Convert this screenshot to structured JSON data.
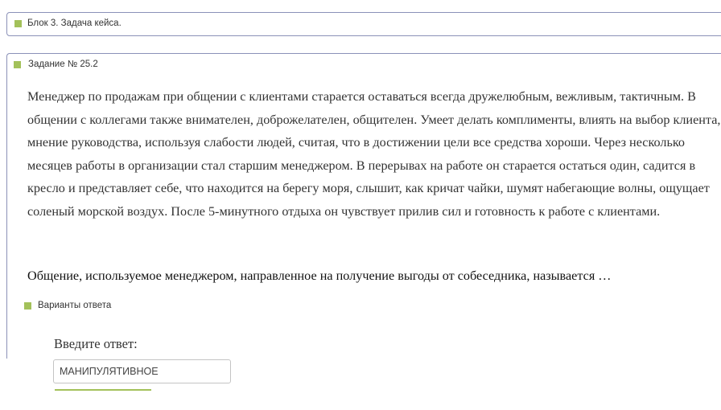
{
  "block": {
    "title": "Блок 3. Задача кейса."
  },
  "task": {
    "title": "Задание № 25.2",
    "text": "Менеджер по продажам при общении с клиентами старается оставаться всегда дружелюбным, вежливым, тактичным. В общении с коллегами также внимателен, доброжелателен, общителен. Умеет делать комплименты, влиять на выбор клиента, мнение руководства, используя слабости людей, считая, что в достижении цели все средства хороши. Через несколько месяцев работы в организации стал старшим менеджером. В перерывах на работе он старается остаться один, садится в кресло и представляет себе, что находится на берегу моря, слышит, как кричат чайки, шумят набегающие волны, ощущает соленый морской воздух. После 5-минутного отдыха он чувствует прилив сил и готовность к работе с клиентами.",
    "question": "Общение, используемое менеджером, направленное на получение выгоды от собеседника, называется …"
  },
  "answers": {
    "title": "Варианты ответа",
    "prompt": "Введите ответ:",
    "value": "МАНИПУЛЯТИВНОЕ"
  },
  "colors": {
    "accent": "#a3c15a",
    "border": "#8b91b8"
  }
}
